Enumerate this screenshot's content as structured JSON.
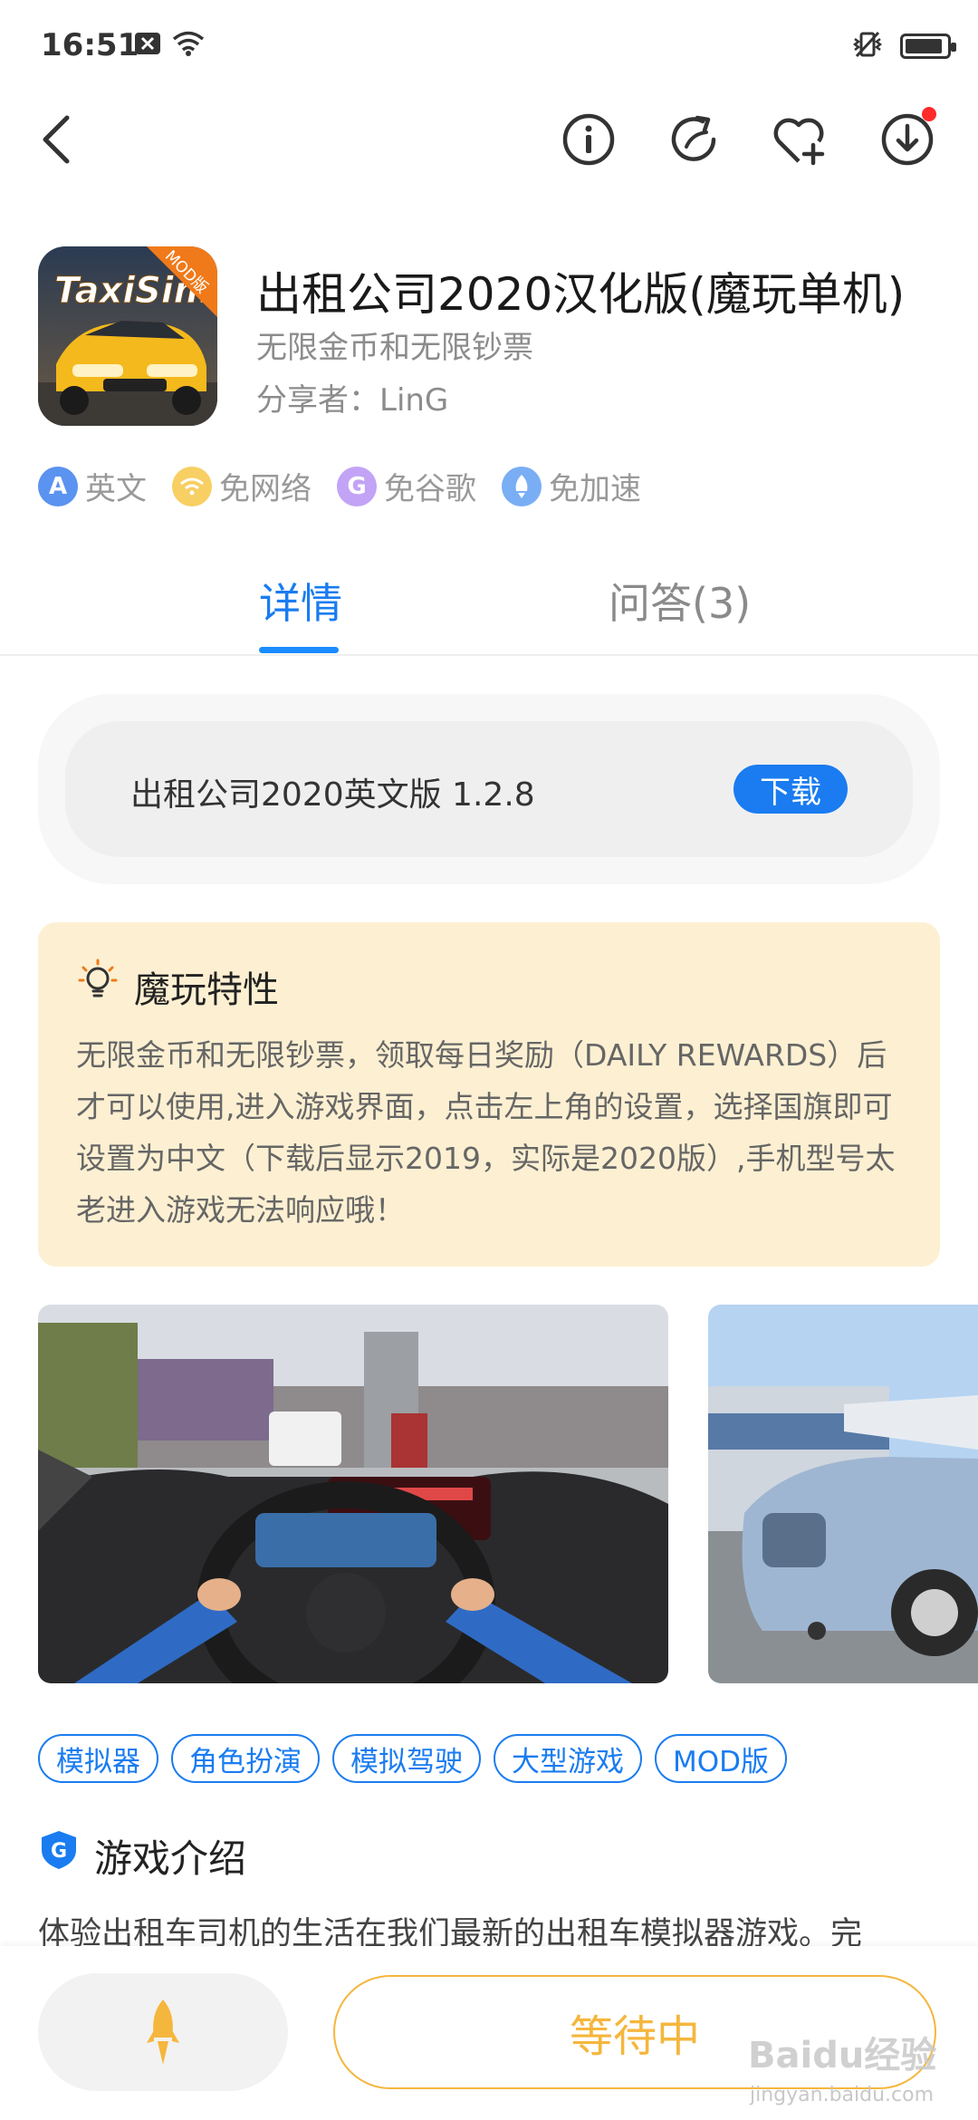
{
  "status_bar": {
    "time": "16:51"
  },
  "header_icons": [
    "back-arrow-icon",
    "info-icon",
    "share-icon",
    "favorite-add-icon",
    "download-icon"
  ],
  "app": {
    "icon_badge": "MOD版",
    "icon_text": "TaxiSim",
    "title": "出租公司2020汉化版(魔玩单机)",
    "subtitle": "无限金币和无限钞票",
    "sharer": "分享者：LinG"
  },
  "features": [
    {
      "label": "英文",
      "icon": "A",
      "color": "#4a8df0"
    },
    {
      "label": "免网络",
      "icon": "wifi-icon",
      "color": "#f5c542"
    },
    {
      "label": "免谷歌",
      "icon": "G",
      "color": "#b18cf0"
    },
    {
      "label": "免加速",
      "icon": "rocket-icon",
      "color": "#5aa0f2"
    }
  ],
  "tabs": {
    "details": "详情",
    "qa": "问答(3)"
  },
  "version": {
    "text": "出租公司2020英文版 1.2.8",
    "download_label": "下载"
  },
  "mod_features": {
    "title": "魔玩特性",
    "body": "无限金币和无限钞票，领取每日奖励（DAILY REWARDS）后才可以使用,进入游戏界面，点击左上角的设置，选择国旗即可设置为中文（下载后显示2019，实际是2020版）,手机型号太老进入游戏无法响应哦！"
  },
  "tags": [
    "模拟器",
    "角色扮演",
    "模拟驾驶",
    "大型游戏",
    "MOD版"
  ],
  "intro": {
    "title": "游戏介绍",
    "text": "体验出租车司机的生活在我们最新的出租车模拟器游戏。完"
  },
  "bottom": {
    "wait_label": "等待中"
  },
  "watermark": {
    "brand": "Baidu经验",
    "url": "jingyan.baidu.com"
  },
  "colors": {
    "accent": "#1a7cf0",
    "wait": "#f5b63d",
    "feature_bg": "#fdf0d2"
  }
}
